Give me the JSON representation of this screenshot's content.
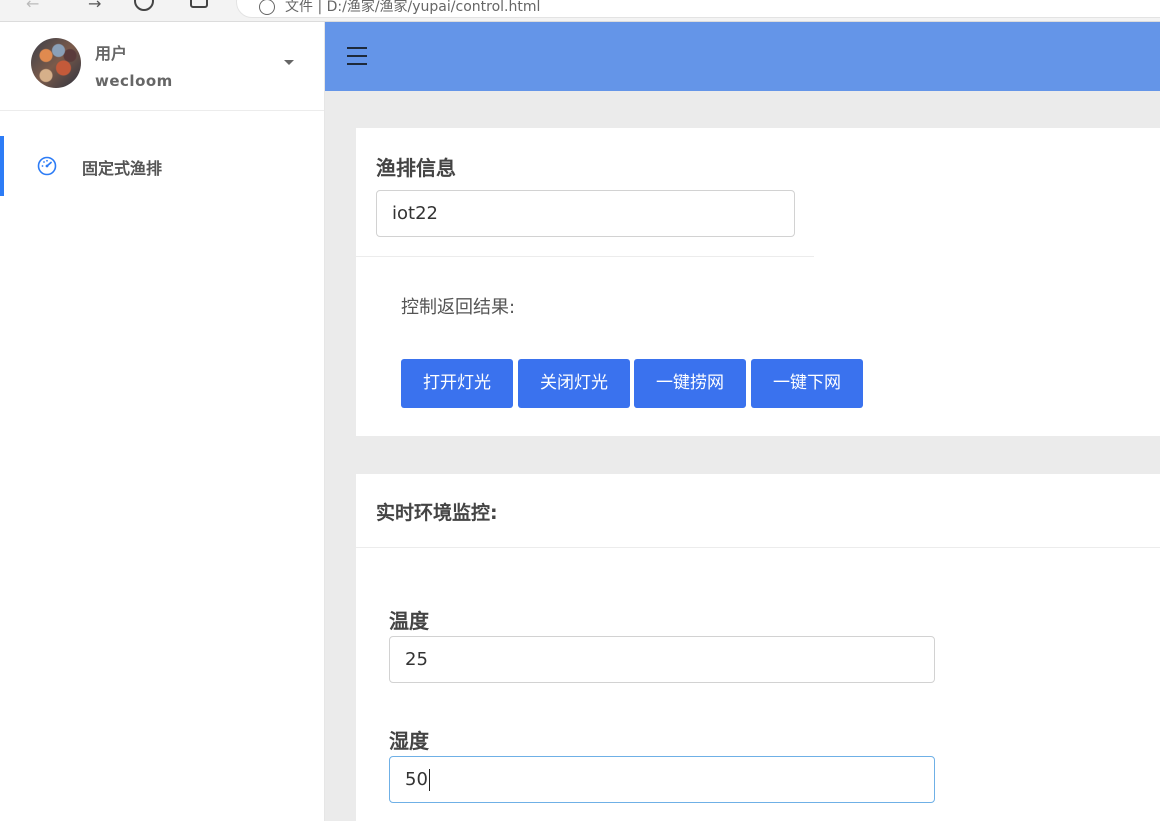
{
  "browser": {
    "address": "文件 | D:/渔家/渔家/yupai/control.html"
  },
  "sidebar": {
    "user": {
      "role": "用户",
      "name": "wecloom"
    },
    "items": [
      {
        "label": "固定式渔排",
        "icon": "dashboard-icon",
        "active": true
      }
    ]
  },
  "colors": {
    "accent": "#2d7cf6",
    "topbar": "#6495e8",
    "button": "#3a72ee"
  },
  "control_card": {
    "title": "渔排信息",
    "device_value": "iot22",
    "result_label": "控制返回结果:",
    "buttons": {
      "light_on": "打开灯光",
      "light_off": "关闭灯光",
      "net_up": "一键捞网",
      "net_down": "一键下网"
    }
  },
  "monitor_card": {
    "title": "实时环境监控:",
    "temperature": {
      "label": "温度",
      "value": "25"
    },
    "humidity": {
      "label": "湿度",
      "value": "50"
    }
  }
}
